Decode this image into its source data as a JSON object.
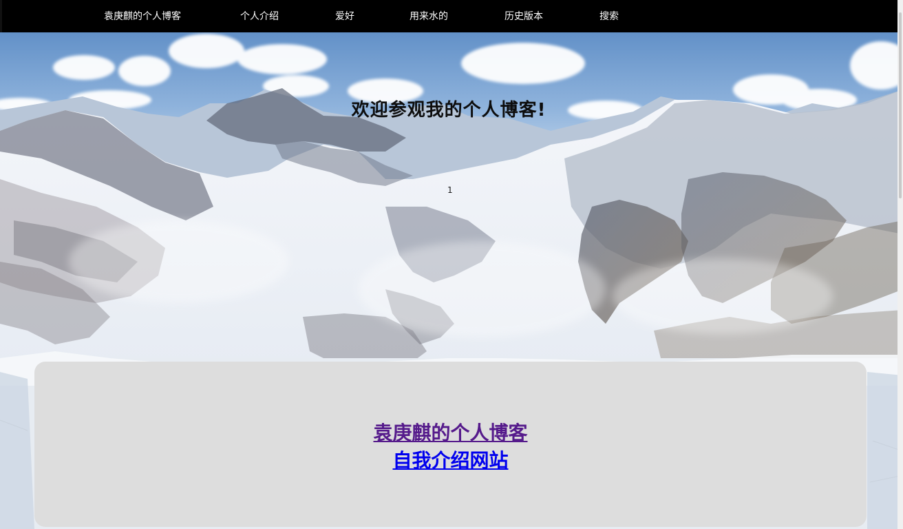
{
  "nav": {
    "items": [
      {
        "label": "袁庚麒的个人博客"
      },
      {
        "label": "个人介绍"
      },
      {
        "label": "爱好"
      },
      {
        "label": "用来水的"
      },
      {
        "label": "历史版本"
      },
      {
        "label": "搜索"
      }
    ],
    "background": "#000000",
    "text_color": "#ffffff"
  },
  "hero": {
    "title": "欢迎参观我的个人博客!",
    "marker": "1"
  },
  "card": {
    "background": "#dddddd",
    "links": [
      {
        "label": "袁庚麒的个人博客",
        "color": "#551a8b"
      },
      {
        "label": "自我介绍网站",
        "color": "#0000ee"
      }
    ]
  }
}
